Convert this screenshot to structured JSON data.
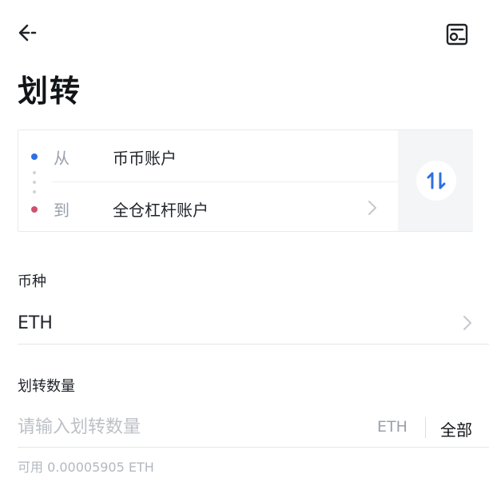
{
  "header": {
    "back_icon": "back-arrow-icon",
    "record_icon": "transfer-record-icon",
    "title": "划转"
  },
  "transfer": {
    "from_label": "从",
    "from_account": "币币账户",
    "to_label": "到",
    "to_account": "全仓杠杆账户",
    "swap_icon": "swap-arrows-icon",
    "colors": {
      "from_dot": "#2f6fe0",
      "to_dot": "#d1506d",
      "swap_accent": "#2f6fe0"
    }
  },
  "coin": {
    "label": "币种",
    "value": "ETH"
  },
  "amount": {
    "label": "划转数量",
    "placeholder": "请输入划转数量",
    "value": "",
    "unit": "ETH",
    "all_label": "全部"
  },
  "available": "可用 0.00005905 ETH"
}
